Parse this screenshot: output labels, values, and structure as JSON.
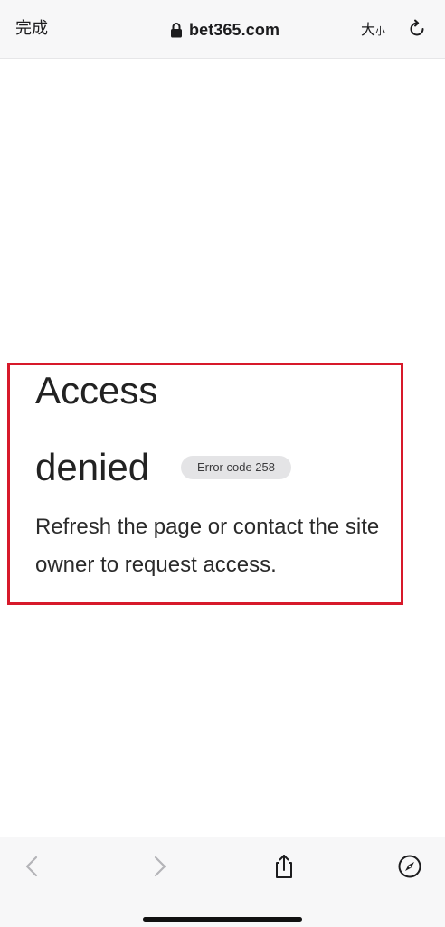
{
  "toolbar": {
    "done_label": "完成",
    "domain": "bet365.com",
    "text_size_big": "大",
    "text_size_small": "小"
  },
  "icons": {
    "lock": "lock-icon",
    "reload": "reload-icon",
    "back": "chevron-left-icon",
    "forward": "chevron-right-icon",
    "share": "share-icon",
    "compass": "compass-icon"
  },
  "error_page": {
    "title_line1": "Access",
    "title_line2": "denied",
    "error_code": "Error code 258",
    "message": "Refresh the page or contact the site owner to request access."
  },
  "colors": {
    "highlight_border": "#d7192a",
    "badge_bg": "#e4e4e6",
    "bar_bg": "#f7f7f8",
    "disabled_nav": "#b4b4b8"
  }
}
